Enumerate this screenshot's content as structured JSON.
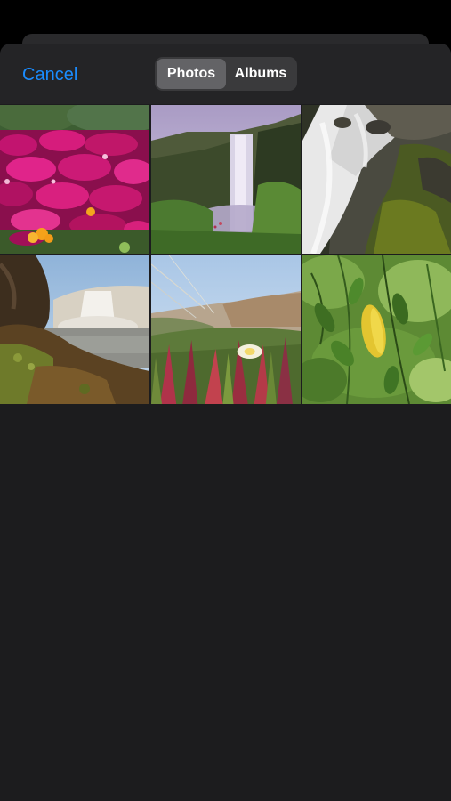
{
  "nav": {
    "cancel_label": "Cancel",
    "tabs": [
      {
        "label": "Photos",
        "active": true
      },
      {
        "label": "Albums",
        "active": false
      }
    ]
  },
  "colors": {
    "accent": "#1a8cff",
    "sheet_background": "#1c1c1e",
    "navbar_background": "#242426",
    "segment_track": "#3a3a3c",
    "segment_selected": "#636366"
  },
  "photos": [
    {
      "name": "photo-pink-flowers",
      "subject": "pink flowers"
    },
    {
      "name": "photo-waterfall-cliff",
      "subject": "waterfall"
    },
    {
      "name": "photo-waterfall-closeup",
      "subject": "waterfall"
    },
    {
      "name": "photo-coastal-waterfall",
      "subject": "waterfall"
    },
    {
      "name": "photo-ice-plant-dunes",
      "subject": "flowers"
    },
    {
      "name": "photo-green-leaves",
      "subject": "leaves"
    }
  ]
}
